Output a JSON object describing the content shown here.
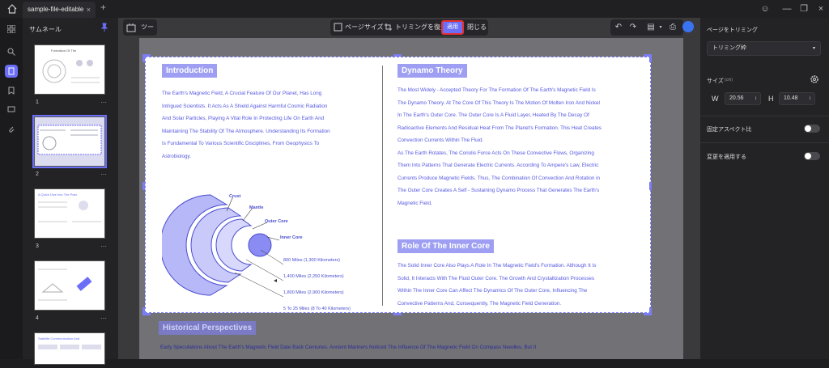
{
  "app": {
    "tab_title": "sample-file-editable"
  },
  "thumbnails": {
    "title": "サムネール",
    "pages": [
      "1",
      "2",
      "3",
      "4"
    ]
  },
  "toolbar": {
    "tool_label": "ツール",
    "page_size": "ページサイズ",
    "restore_trim": "トリミングを復元",
    "apply": "適用",
    "close": "閉じる"
  },
  "doc": {
    "intro_heading": "Introduction",
    "intro_lines": [
      "The Earth's Magnetic Field, A Crucial Feature Of Our Planet, Has Long",
      "Intrigued Scientists. It Acts As A Shield Against Harmful Cosmic Radiation",
      "And Solar Particles, Playing A Vital Role In Protecting Life On Earth And",
      "Maintaining The Stability Of The Atmosphere. Understanding Its Formation",
      "Is Fundamental To Various Scientific Disciplines, From Geophysics To",
      "Astrobiology."
    ],
    "layers": {
      "crust": "Crust",
      "mantle": "Mantle",
      "outer_core": "Outer Core",
      "inner_core": "Inner Core"
    },
    "distances": [
      "800 Miles (1,300 Kilometers)",
      "1,400 Miles (2,250 Kilometers)",
      "1,800 Miles (2,900 Kilometers)",
      "5 To 25 Miles (8 To 40 Kilometers)"
    ],
    "dynamo_heading": "Dynamo Theory",
    "dynamo_lines": [
      "The Most Widely - Accepted Theory For The Formation Of The Earth's Magnetic Field Is",
      "The Dynamo Theory. At The Core Of This Theory Is The Motion Of Molten Iron And Nickel",
      "In The Earth's Outer Core. The Outer Core Is A Fluid Layer, Heated By The Decay Of",
      "Radioactive Elements And Residual Heat From The Planet's Formation. This Heat Creates",
      "Convection Currents Within The Fluid.",
      "As The Earth Rotates, The Coriolis Force Acts On These Convective Flows, Organizing",
      "Them Into Patterns That Generate Electric Currents. According To Ampere's Law, Electric",
      "Currents Produce Magnetic Fields. Thus, The Combination Of Convection And Rotation in",
      "The Outer Core Creates A Self - Sustaining Dynamo Process That Generates The Earth's",
      "Magnetic Field."
    ],
    "inner_heading": "Role Of The Inner Core",
    "inner_lines": [
      "The Solid Inner Core Also Plays A Role In The Magnetic Field's Formation. Although It Is",
      "Solid, It Interacts With The Fluid Outer Core. The Growth And Crystallization Processes",
      "Within The Inner Core Can Affect The Dynamics Of The Outer Core, Influencing The",
      "Convective Patterns And, Consequently, The Magnetic Field Generation."
    ],
    "hist_heading": "Historical Perspectives",
    "hist_line": "Early Speculations About The Earth's Magnetic Field Date Back Centuries. Ancient Mariners Noticed The Influence Of The Magnetic Field On Compass Needles, But It"
  },
  "panel": {
    "title": "ページをトリミング",
    "mode": "トリミング枠",
    "size_label": "サイズ",
    "size_unit": "(cm)",
    "w_label": "W",
    "w_value": "20.56",
    "h_label": "H",
    "h_value": "10.48",
    "aspect_label": "固定アスペクト比",
    "apply_label": "変更を適用する"
  },
  "colors": {
    "accent": "#6b6ef7",
    "highlight": "#e53030",
    "doc_text": "#5558e0"
  }
}
